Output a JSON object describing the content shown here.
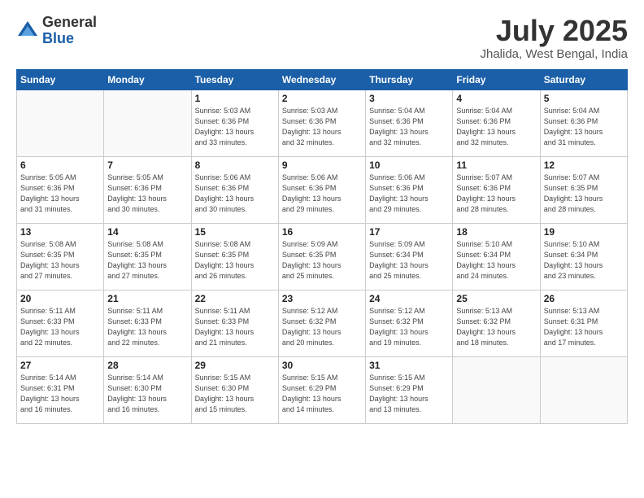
{
  "header": {
    "logo_general": "General",
    "logo_blue": "Blue",
    "month_title": "July 2025",
    "location": "Jhalida, West Bengal, India"
  },
  "weekdays": [
    "Sunday",
    "Monday",
    "Tuesday",
    "Wednesday",
    "Thursday",
    "Friday",
    "Saturday"
  ],
  "weeks": [
    [
      {
        "day": "",
        "info": ""
      },
      {
        "day": "",
        "info": ""
      },
      {
        "day": "1",
        "info": "Sunrise: 5:03 AM\nSunset: 6:36 PM\nDaylight: 13 hours\nand 33 minutes."
      },
      {
        "day": "2",
        "info": "Sunrise: 5:03 AM\nSunset: 6:36 PM\nDaylight: 13 hours\nand 32 minutes."
      },
      {
        "day": "3",
        "info": "Sunrise: 5:04 AM\nSunset: 6:36 PM\nDaylight: 13 hours\nand 32 minutes."
      },
      {
        "day": "4",
        "info": "Sunrise: 5:04 AM\nSunset: 6:36 PM\nDaylight: 13 hours\nand 32 minutes."
      },
      {
        "day": "5",
        "info": "Sunrise: 5:04 AM\nSunset: 6:36 PM\nDaylight: 13 hours\nand 31 minutes."
      }
    ],
    [
      {
        "day": "6",
        "info": "Sunrise: 5:05 AM\nSunset: 6:36 PM\nDaylight: 13 hours\nand 31 minutes."
      },
      {
        "day": "7",
        "info": "Sunrise: 5:05 AM\nSunset: 6:36 PM\nDaylight: 13 hours\nand 30 minutes."
      },
      {
        "day": "8",
        "info": "Sunrise: 5:06 AM\nSunset: 6:36 PM\nDaylight: 13 hours\nand 30 minutes."
      },
      {
        "day": "9",
        "info": "Sunrise: 5:06 AM\nSunset: 6:36 PM\nDaylight: 13 hours\nand 29 minutes."
      },
      {
        "day": "10",
        "info": "Sunrise: 5:06 AM\nSunset: 6:36 PM\nDaylight: 13 hours\nand 29 minutes."
      },
      {
        "day": "11",
        "info": "Sunrise: 5:07 AM\nSunset: 6:36 PM\nDaylight: 13 hours\nand 28 minutes."
      },
      {
        "day": "12",
        "info": "Sunrise: 5:07 AM\nSunset: 6:35 PM\nDaylight: 13 hours\nand 28 minutes."
      }
    ],
    [
      {
        "day": "13",
        "info": "Sunrise: 5:08 AM\nSunset: 6:35 PM\nDaylight: 13 hours\nand 27 minutes."
      },
      {
        "day": "14",
        "info": "Sunrise: 5:08 AM\nSunset: 6:35 PM\nDaylight: 13 hours\nand 27 minutes."
      },
      {
        "day": "15",
        "info": "Sunrise: 5:08 AM\nSunset: 6:35 PM\nDaylight: 13 hours\nand 26 minutes."
      },
      {
        "day": "16",
        "info": "Sunrise: 5:09 AM\nSunset: 6:35 PM\nDaylight: 13 hours\nand 25 minutes."
      },
      {
        "day": "17",
        "info": "Sunrise: 5:09 AM\nSunset: 6:34 PM\nDaylight: 13 hours\nand 25 minutes."
      },
      {
        "day": "18",
        "info": "Sunrise: 5:10 AM\nSunset: 6:34 PM\nDaylight: 13 hours\nand 24 minutes."
      },
      {
        "day": "19",
        "info": "Sunrise: 5:10 AM\nSunset: 6:34 PM\nDaylight: 13 hours\nand 23 minutes."
      }
    ],
    [
      {
        "day": "20",
        "info": "Sunrise: 5:11 AM\nSunset: 6:33 PM\nDaylight: 13 hours\nand 22 minutes."
      },
      {
        "day": "21",
        "info": "Sunrise: 5:11 AM\nSunset: 6:33 PM\nDaylight: 13 hours\nand 22 minutes."
      },
      {
        "day": "22",
        "info": "Sunrise: 5:11 AM\nSunset: 6:33 PM\nDaylight: 13 hours\nand 21 minutes."
      },
      {
        "day": "23",
        "info": "Sunrise: 5:12 AM\nSunset: 6:32 PM\nDaylight: 13 hours\nand 20 minutes."
      },
      {
        "day": "24",
        "info": "Sunrise: 5:12 AM\nSunset: 6:32 PM\nDaylight: 13 hours\nand 19 minutes."
      },
      {
        "day": "25",
        "info": "Sunrise: 5:13 AM\nSunset: 6:32 PM\nDaylight: 13 hours\nand 18 minutes."
      },
      {
        "day": "26",
        "info": "Sunrise: 5:13 AM\nSunset: 6:31 PM\nDaylight: 13 hours\nand 17 minutes."
      }
    ],
    [
      {
        "day": "27",
        "info": "Sunrise: 5:14 AM\nSunset: 6:31 PM\nDaylight: 13 hours\nand 16 minutes."
      },
      {
        "day": "28",
        "info": "Sunrise: 5:14 AM\nSunset: 6:30 PM\nDaylight: 13 hours\nand 16 minutes."
      },
      {
        "day": "29",
        "info": "Sunrise: 5:15 AM\nSunset: 6:30 PM\nDaylight: 13 hours\nand 15 minutes."
      },
      {
        "day": "30",
        "info": "Sunrise: 5:15 AM\nSunset: 6:29 PM\nDaylight: 13 hours\nand 14 minutes."
      },
      {
        "day": "31",
        "info": "Sunrise: 5:15 AM\nSunset: 6:29 PM\nDaylight: 13 hours\nand 13 minutes."
      },
      {
        "day": "",
        "info": ""
      },
      {
        "day": "",
        "info": ""
      }
    ]
  ]
}
